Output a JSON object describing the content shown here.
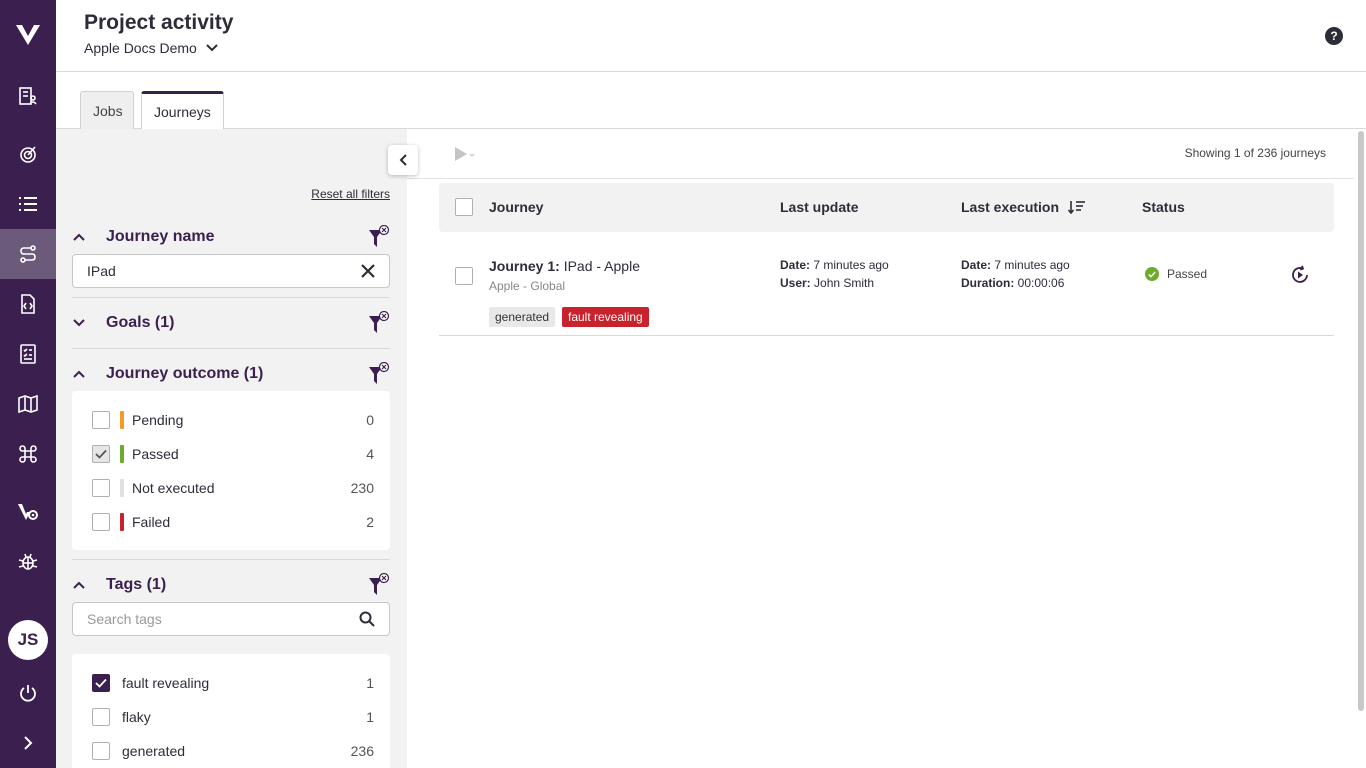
{
  "header": {
    "title": "Project activity",
    "project": "Apple Docs Demo",
    "help_label": "?"
  },
  "rail": {
    "avatar_initials": "JS"
  },
  "tabs": [
    {
      "label": "Jobs"
    },
    {
      "label": "Journeys"
    }
  ],
  "filters": {
    "reset_label": "Reset all filters",
    "journey_name": {
      "title": "Journey name",
      "value": "IPad"
    },
    "goals": {
      "title": "Goals (1)"
    },
    "outcome": {
      "title": "Journey outcome (1)",
      "options": [
        {
          "label": "Pending",
          "count": "0",
          "color": "#f59a23"
        },
        {
          "label": "Passed",
          "count": "4",
          "color": "#6dab2e"
        },
        {
          "label": "Not executed",
          "count": "230",
          "color": "#e0e0e0"
        },
        {
          "label": "Failed",
          "count": "2",
          "color": "#c8232c"
        }
      ]
    },
    "tags": {
      "title": "Tags (1)",
      "search_placeholder": "Search tags",
      "options": [
        {
          "label": "fault revealing",
          "count": "1"
        },
        {
          "label": "flaky",
          "count": "1"
        },
        {
          "label": "generated",
          "count": "236"
        }
      ]
    }
  },
  "main": {
    "showing": "Showing 1 of 236 journeys",
    "columns": {
      "journey": "Journey",
      "last_update": "Last update",
      "last_execution": "Last execution",
      "status": "Status"
    },
    "rows": [
      {
        "title_prefix": "Journey 1:",
        "title": " IPad - Apple",
        "subtitle": "Apple - Global",
        "tags": [
          "generated",
          "fault revealing"
        ],
        "update_date_label": "Date:",
        "update_date": " 7 minutes ago",
        "update_user_label": "User:",
        "update_user": " John Smith",
        "exec_date_label": "Date:",
        "exec_date": " 7 minutes ago",
        "exec_duration_label": "Duration:",
        "exec_duration": " 00:00:06",
        "status": "Passed"
      }
    ]
  },
  "colors": {
    "brand": "#3b1f4f",
    "passed": "#6dab2e",
    "failed": "#c8232c",
    "pending": "#f59a23"
  }
}
